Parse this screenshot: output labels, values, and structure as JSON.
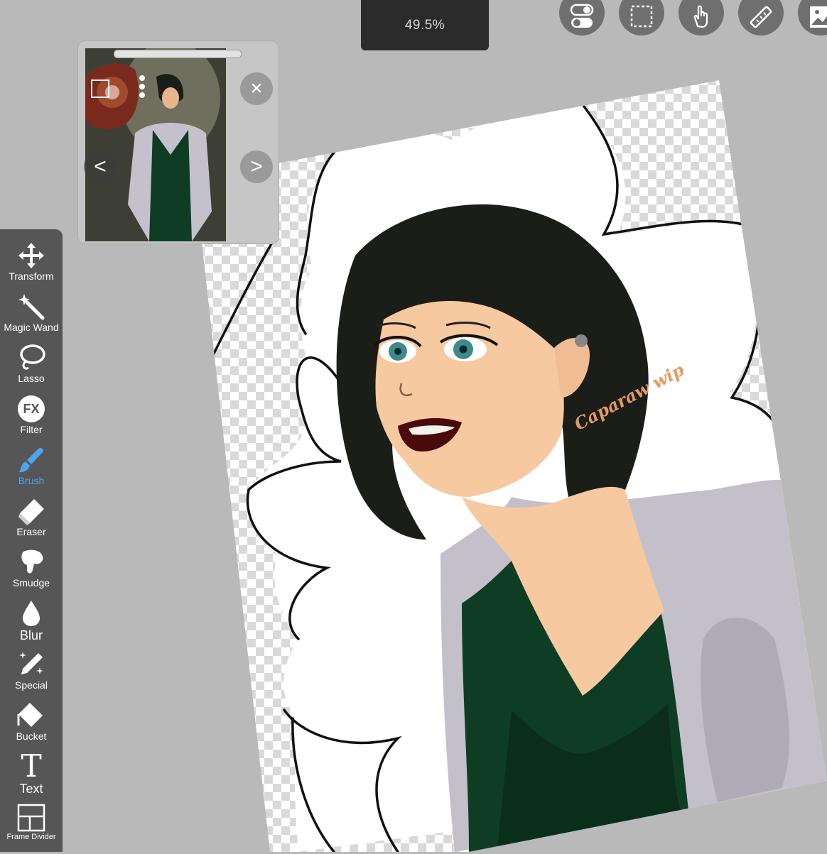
{
  "zoom_label": "49.5%",
  "watermark": "Caparaw wip",
  "top_buttons": [
    {
      "name": "toggle-icon"
    },
    {
      "name": "selection-icon"
    },
    {
      "name": "hand-icon"
    },
    {
      "name": "ruler-icon"
    },
    {
      "name": "image-icon"
    }
  ],
  "reference_window": {
    "prev_label": "<",
    "next_label": ">",
    "close_label": "×"
  },
  "tools": [
    {
      "id": "transform",
      "label": "Transform",
      "icon": "move-icon"
    },
    {
      "id": "magic-wand",
      "label": "Magic Wand",
      "icon": "magic-wand-icon"
    },
    {
      "id": "lasso",
      "label": "Lasso",
      "icon": "lasso-icon"
    },
    {
      "id": "filter",
      "label": "Filter",
      "icon": "fx-icon",
      "glyph": "FX"
    },
    {
      "id": "brush",
      "label": "Brush",
      "icon": "brush-icon",
      "active": true
    },
    {
      "id": "eraser",
      "label": "Eraser",
      "icon": "eraser-icon"
    },
    {
      "id": "smudge",
      "label": "Smudge",
      "icon": "smudge-icon"
    },
    {
      "id": "blur",
      "label": "Blur",
      "icon": "drop-icon"
    },
    {
      "id": "special",
      "label": "Special",
      "icon": "sparkle-pen-icon"
    },
    {
      "id": "bucket",
      "label": "Bucket",
      "icon": "bucket-icon"
    },
    {
      "id": "text",
      "label": "Text",
      "icon": "text-icon",
      "glyph": "T"
    },
    {
      "id": "frame-divider",
      "label": "Frame Divider",
      "icon": "frame-divider-icon"
    }
  ],
  "colors": {
    "background": "#b9b9b9",
    "toolbar": "#565656",
    "active": "#4aa6f0",
    "hair": "#1b1d18",
    "dress": "#0f3d24",
    "skin": "#f6c9a0",
    "coat": "#c4c0ca",
    "lips": "#4a0a0c",
    "eyes": "#3c8a89"
  }
}
